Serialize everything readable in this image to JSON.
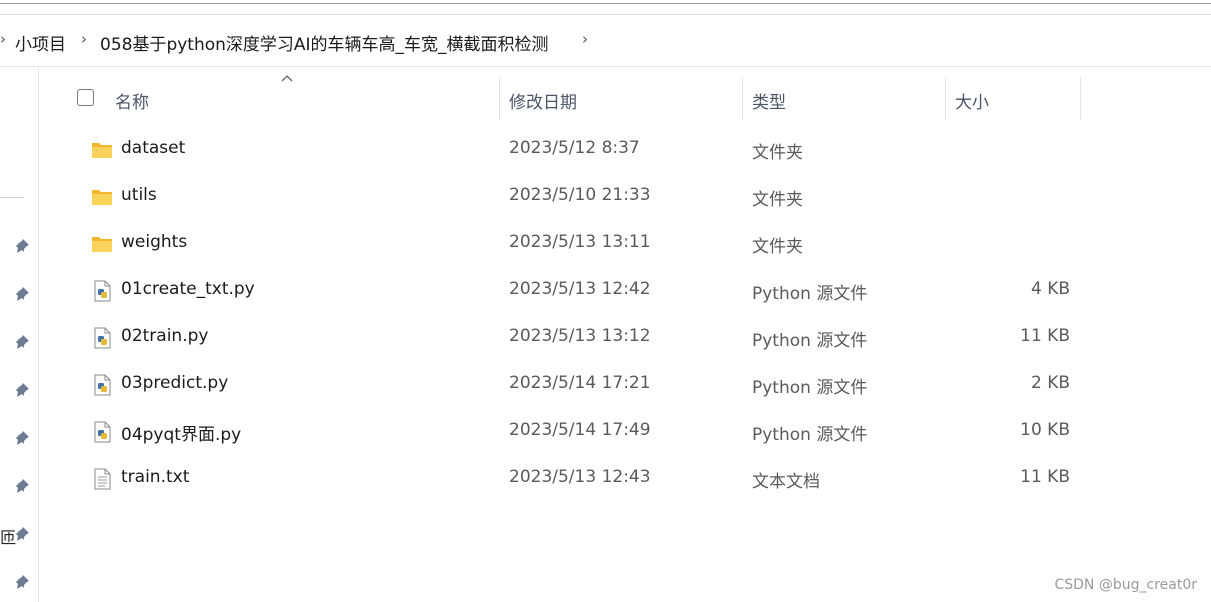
{
  "breadcrumb": {
    "items": [
      "小项目",
      "058基于python深度学习AI的车辆车高_车宽_横截面积检测"
    ]
  },
  "header": {
    "name": "名称",
    "date": "修改日期",
    "type": "类型",
    "size": "大小"
  },
  "files": [
    {
      "name": "dataset",
      "date": "2023/5/12 8:37",
      "type": "文件夹",
      "size": "",
      "icon": "folder-icon"
    },
    {
      "name": "utils",
      "date": "2023/5/10 21:33",
      "type": "文件夹",
      "size": "",
      "icon": "folder-icon"
    },
    {
      "name": "weights",
      "date": "2023/5/13 13:11",
      "type": "文件夹",
      "size": "",
      "icon": "folder-icon"
    },
    {
      "name": "01create_txt.py",
      "date": "2023/5/13 12:42",
      "type": "Python 源文件",
      "size": "4 KB",
      "icon": "python-file-icon"
    },
    {
      "name": "02train.py",
      "date": "2023/5/13 13:12",
      "type": "Python 源文件",
      "size": "11 KB",
      "icon": "python-file-icon"
    },
    {
      "name": "03predict.py",
      "date": "2023/5/14 17:21",
      "type": "Python 源文件",
      "size": "2 KB",
      "icon": "python-file-icon"
    },
    {
      "name": "04pyqt界面.py",
      "date": "2023/5/14 17:49",
      "type": "Python 源文件",
      "size": "10 KB",
      "icon": "python-file-icon"
    },
    {
      "name": "train.txt",
      "date": "2023/5/13 12:43",
      "type": "文本文档",
      "size": "11 KB",
      "icon": "text-file-icon"
    }
  ],
  "sidebar": {
    "cut_label": "匝"
  },
  "watermark": "CSDN @bug_creat0r",
  "colors": {
    "folder": "#f6c342",
    "python_blue": "#3f72a8",
    "python_yellow": "#e6b93a",
    "pin": "#6b7c8f"
  }
}
